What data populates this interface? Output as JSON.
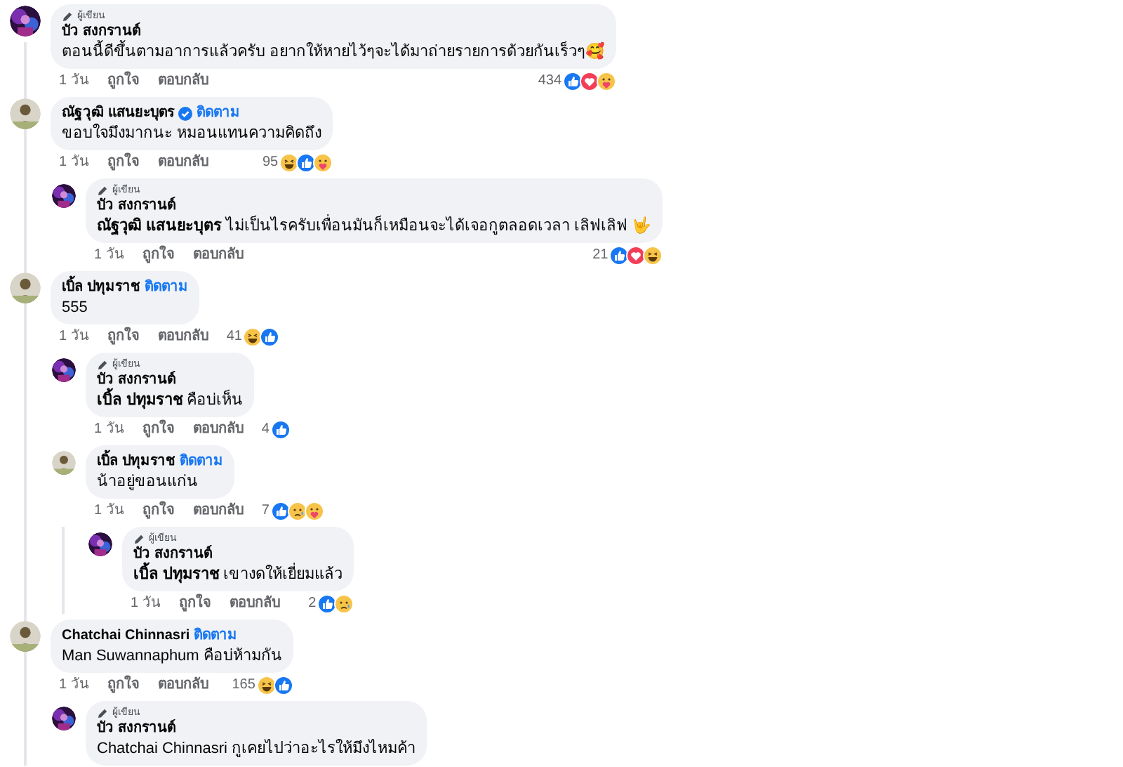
{
  "comments": [
    {
      "badge": "ผู้เขียน",
      "name": "บัว สงกรานต์",
      "verified": false,
      "text": "ตอนนี้ดีขึ้นตามอาการแล้วครับ อยากให้หายไว้ๆจะได้มาถ่ายรายการด้วยกันเร็วๆ🥰",
      "time": "1 วัน",
      "like": "ถูกใจ",
      "reply": "ตอบกลับ",
      "reaction_count": "434",
      "reactions": [
        {
          "kind": "like"
        },
        {
          "kind": "love"
        },
        {
          "kind": "care"
        }
      ]
    },
    {
      "name": "ณัฐวุฒิ แสนยะบุตร",
      "verified": true,
      "follow": "ติดตาม",
      "text": "ขอบใจมึงมากนะ หมอนแทนความคิดถึง",
      "time": "1 วัน",
      "like": "ถูกใจ",
      "reply": "ตอบกลับ",
      "reaction_count": "95",
      "reactions": [
        {
          "kind": "haha"
        },
        {
          "kind": "like"
        },
        {
          "kind": "care"
        }
      ],
      "children": [
        {
          "badge": "ผู้เขียน",
          "name": "บัว สงกรานต์",
          "verified": false,
          "text": "**ณัฐวุฒิ แสนยะบุตร** ไม่เป็นไรครับเพื่อนมันก็เหมือนจะได้เจอกูตลอดเวลา เลิฟเลิฟ 🤟",
          "time": "1 วัน",
          "like": "ถูกใจ",
          "reply": "ตอบกลับ",
          "reaction_count": "21",
          "reactions": [
            {
              "kind": "like"
            },
            {
              "kind": "love"
            },
            {
              "kind": "haha"
            }
          ]
        }
      ]
    },
    {
      "name": "เบิ้ล ปทุมราช",
      "verified": false,
      "follow": "ติดตาม",
      "text": "555",
      "time": "1 วัน",
      "like": "ถูกใจ",
      "reply": "ตอบกลับ",
      "reaction_count": "41",
      "reactions": [
        {
          "kind": "haha"
        },
        {
          "kind": "like"
        }
      ],
      "children": [
        {
          "badge": "ผู้เขียน",
          "name": "บัว สงกรานต์",
          "verified": false,
          "text": "**เบิ้ล ปทุมราช** คือบ่เห็น",
          "time": "1 วัน",
          "like": "ถูกใจ",
          "reply": "ตอบกลับ",
          "reaction_count": "4",
          "reactions": [
            {
              "kind": "like"
            }
          ]
        },
        {
          "name": "เบิ้ล ปทุมราช",
          "verified": false,
          "follow": "ติดตาม",
          "text": "น้าอยู่ขอนแก่น",
          "time": "1 วัน",
          "like": "ถูกใจ",
          "reply": "ตอบกลับ",
          "reaction_count": "7",
          "reactions": [
            {
              "kind": "like"
            },
            {
              "kind": "sad"
            },
            {
              "kind": "care"
            }
          ],
          "children": [
            {
              "badge": "ผู้เขียน",
              "name": "บัว สงกรานต์",
              "verified": false,
              "text": "**เบิ้ล ปทุมราช** เขางดให้เยี่ยมแล้ว",
              "time": "1 วัน",
              "like": "ถูกใจ",
              "reply": "ตอบกลับ",
              "reaction_count": "2",
              "reactions": [
                {
                  "kind": "like"
                },
                {
                  "kind": "sad"
                }
              ]
            }
          ]
        }
      ]
    },
    {
      "name": "Chatchai Chinnasri",
      "verified": false,
      "follow": "ติดตาม",
      "text": "Man Suwannaphum คือบ่ห้ามกัน",
      "time": "1 วัน",
      "like": "ถูกใจ",
      "reply": "ตอบกลับ",
      "reaction_count": "165",
      "reactions": [
        {
          "kind": "haha"
        },
        {
          "kind": "like"
        }
      ],
      "children": [
        {
          "badge": "ผู้เขียน",
          "name": "บัว สงกรานต์",
          "verified": false,
          "text": "Chatchai Chinnasri กูเคยไปว่าอะไรให้มึงไหมค้า"
        }
      ]
    }
  ]
}
